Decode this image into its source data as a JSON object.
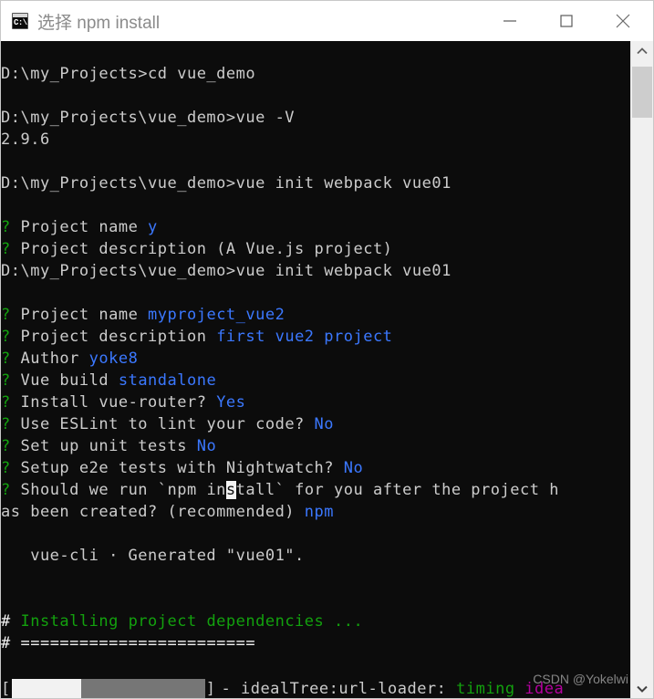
{
  "window": {
    "title": "选择 npm install",
    "icon": "console-icon",
    "icon_glyph": "C:\\.",
    "controls": {
      "minimize": "minimize-button",
      "maximize": "maximize-button",
      "close": "close-button"
    }
  },
  "terminal": {
    "background": "#0c0c0c",
    "foreground": "#cccccc",
    "colors": {
      "green": "#13a10e",
      "bright_green": "#16c60c",
      "blue": "#3b78ff",
      "cyan": "#61d6d6",
      "magenta": "#b4009e",
      "white": "#f2f2f2",
      "gray": "#767676"
    },
    "lines": [
      {
        "id": "line-blank-1",
        "segments": []
      },
      {
        "id": "line-cd",
        "segments": [
          {
            "text": "D:\\my_Projects>cd vue_demo",
            "color": "default"
          }
        ]
      },
      {
        "id": "line-blank-2",
        "segments": []
      },
      {
        "id": "line-vue-v",
        "segments": [
          {
            "text": "D:\\my_Projects\\vue_demo>vue -V",
            "color": "default"
          }
        ]
      },
      {
        "id": "line-version",
        "segments": [
          {
            "text": "2.9.6",
            "color": "default"
          }
        ]
      },
      {
        "id": "line-blank-3",
        "segments": []
      },
      {
        "id": "line-init-1",
        "segments": [
          {
            "text": "D:\\my_Projects\\vue_demo>vue init webpack vue01",
            "color": "default"
          }
        ]
      },
      {
        "id": "line-blank-4",
        "segments": []
      },
      {
        "id": "line-q-name-1",
        "segments": [
          {
            "text": "? ",
            "color": "green"
          },
          {
            "text": "Project name ",
            "color": "default"
          },
          {
            "text": "y",
            "color": "blue"
          }
        ]
      },
      {
        "id": "line-q-desc-1",
        "segments": [
          {
            "text": "? ",
            "color": "green"
          },
          {
            "text": "Project description (A Vue.js project)",
            "color": "default"
          }
        ]
      },
      {
        "id": "line-init-2",
        "segments": [
          {
            "text": "D:\\my_Projects\\vue_demo>vue init webpack vue01",
            "color": "default"
          }
        ]
      },
      {
        "id": "line-blank-5",
        "segments": []
      },
      {
        "id": "line-q-name-2",
        "segments": [
          {
            "text": "? ",
            "color": "green"
          },
          {
            "text": "Project name ",
            "color": "default"
          },
          {
            "text": "myproject_vue2",
            "color": "blue"
          }
        ]
      },
      {
        "id": "line-q-desc-2",
        "segments": [
          {
            "text": "? ",
            "color": "green"
          },
          {
            "text": "Project description ",
            "color": "default"
          },
          {
            "text": "first vue2 project",
            "color": "blue"
          }
        ]
      },
      {
        "id": "line-q-author",
        "segments": [
          {
            "text": "? ",
            "color": "green"
          },
          {
            "text": "Author ",
            "color": "default"
          },
          {
            "text": "yoke8",
            "color": "blue"
          }
        ]
      },
      {
        "id": "line-q-build",
        "segments": [
          {
            "text": "? ",
            "color": "green"
          },
          {
            "text": "Vue build ",
            "color": "default"
          },
          {
            "text": "standalone",
            "color": "blue"
          }
        ]
      },
      {
        "id": "line-q-router",
        "segments": [
          {
            "text": "? ",
            "color": "green"
          },
          {
            "text": "Install vue-router? ",
            "color": "default"
          },
          {
            "text": "Yes",
            "color": "blue"
          }
        ]
      },
      {
        "id": "line-q-eslint",
        "segments": [
          {
            "text": "? ",
            "color": "green"
          },
          {
            "text": "Use ESLint to lint your code? ",
            "color": "default"
          },
          {
            "text": "No",
            "color": "blue"
          }
        ]
      },
      {
        "id": "line-q-unit",
        "segments": [
          {
            "text": "? ",
            "color": "green"
          },
          {
            "text": "Set up unit tests ",
            "color": "default"
          },
          {
            "text": "No",
            "color": "blue"
          }
        ]
      },
      {
        "id": "line-q-e2e",
        "segments": [
          {
            "text": "? ",
            "color": "green"
          },
          {
            "text": "Setup e2e tests with Nightwatch? ",
            "color": "default"
          },
          {
            "text": "No",
            "color": "blue"
          }
        ]
      },
      {
        "id": "line-q-npm-1",
        "segments": [
          {
            "text": "? ",
            "color": "green"
          },
          {
            "text": "Should we run `npm in",
            "color": "default"
          },
          {
            "text": "s",
            "color": "cursor"
          },
          {
            "text": "tall` for you after the project h",
            "color": "default"
          }
        ]
      },
      {
        "id": "line-q-npm-2",
        "segments": [
          {
            "text": "as been created? (recommended) ",
            "color": "default"
          },
          {
            "text": "npm",
            "color": "blue"
          }
        ]
      },
      {
        "id": "line-blank-6",
        "segments": []
      },
      {
        "id": "line-generated",
        "segments": [
          {
            "text": "   vue-cli · Generated \"vue01\".",
            "color": "default"
          }
        ]
      },
      {
        "id": "line-blank-7",
        "segments": []
      },
      {
        "id": "line-blank-8",
        "segments": []
      },
      {
        "id": "line-installing",
        "segments": [
          {
            "text": "# ",
            "color": "white"
          },
          {
            "text": "Installing project dependencies ...",
            "color": "green"
          }
        ]
      },
      {
        "id": "line-rule",
        "segments": [
          {
            "text": "# ",
            "color": "white"
          },
          {
            "text": "========================",
            "color": "white"
          }
        ]
      },
      {
        "id": "line-blank-9",
        "segments": []
      }
    ],
    "progress": {
      "open_bracket": "[",
      "close_bracket": "]",
      "fill_percent": 36,
      "fill_color": "#f2f2f2",
      "track_color": "#767676",
      "tail": [
        {
          "text": "- idealTree:url-loader: ",
          "color": "default"
        },
        {
          "text": "timing",
          "color": "green"
        },
        {
          "text": " idea",
          "color": "magenta"
        }
      ]
    }
  },
  "watermark": {
    "text": "CSDN @Yokelwi"
  },
  "scrollbar": {
    "up_arrow": "scroll-up-arrow",
    "down_arrow": "scroll-down-arrow",
    "thumb": "scroll-thumb"
  }
}
